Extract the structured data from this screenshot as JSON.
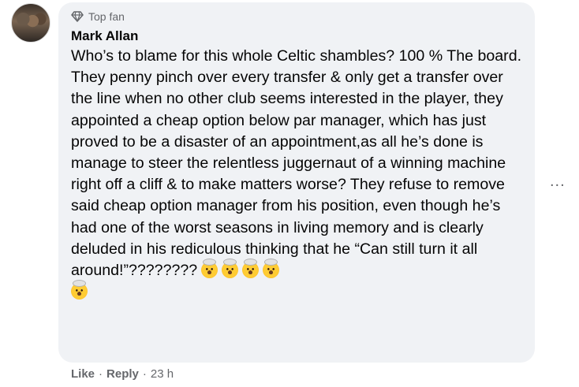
{
  "comment": {
    "badge": "Top fan",
    "author": "Mark Allan",
    "text": "Who’s to blame for this whole Celtic shambles? 100 % The board. They penny pinch over every transfer & only get a transfer over the line when no other club seems interested in the player, they appointed a cheap option below par manager, which has just proved to be a disaster of an appointment,as all he’s done is manage to steer the relentless juggernaut of a winning machine right off a cliff & to make matters worse? They refuse to remove said cheap option manager from his position, even though he’s had one of the worst seasons in living memory and is clearly deluded in his rediculous thinking that he “Can still turn it all around!”????????",
    "emoji_icon": "exploding-head-emoji",
    "emoji_count": 5
  },
  "actions": {
    "like": "Like",
    "reply": "Reply",
    "time": "23 h",
    "separator": "·"
  },
  "more_button": "..."
}
